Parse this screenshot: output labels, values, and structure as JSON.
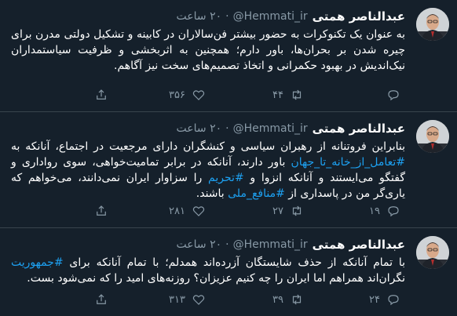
{
  "tweets": [
    {
      "name": "عبدالناصر همتی",
      "handle": "@Hemmati_ir",
      "time": "۲۰ ساعت",
      "text_parts": [
        {
          "text": "به عنوان یک تکنوکرات به حضور بیشتر فن‌سالاران در کابینه و تشکیل دولتی مدرن برای چیره شدن بر بحران‌ها، باور دارم؛ همچنین به اثربخشی و ظرفیت سیاستمداران نیک‌اندیش در بهبود حکمرانی و اتخاذ تصمیم‌های سخت نیز آگاهم.",
          "hashtag": false
        }
      ],
      "replies": "",
      "retweets": "۴۴",
      "likes": "۳۵۶"
    },
    {
      "name": "عبدالناصر همتی",
      "handle": "@Hemmati_ir",
      "time": "۲۰ ساعت",
      "text_parts": [
        {
          "text": "بنابراین فروتنانه از رهبران سیاسی و کنشگران دارای مرجعیت در اجتماع، آنانکه به ",
          "hashtag": false
        },
        {
          "text": "#تعامل_از_خانه_تا_جهان",
          "hashtag": true
        },
        {
          "text": " باور دارند، آنانکه در برابر تمامیت‌خواهی، سوی رواداری و گفتگو می‌ایستند و آنانکه انزوا و ",
          "hashtag": false
        },
        {
          "text": "#تحریم",
          "hashtag": true
        },
        {
          "text": " را سزاوار ایران نمی‌دانند، می‌خواهم که یاری‌گر من در پاسداری از ",
          "hashtag": false
        },
        {
          "text": "#منافع_ملی",
          "hashtag": true
        },
        {
          "text": " باشند.",
          "hashtag": false
        }
      ],
      "replies": "۱۹",
      "retweets": "۲۷",
      "likes": "۲۸۱"
    },
    {
      "name": "عبدالناصر همتی",
      "handle": "@Hemmati_ir",
      "time": "۲۰ ساعت",
      "text_parts": [
        {
          "text": "با تمام آنانکه از حذف شایستگان آزرده‌اند همدلم؛ با تمام آنانکه برای ",
          "hashtag": false
        },
        {
          "text": "#جمهوریت",
          "hashtag": true
        },
        {
          "text": " نگران‌اند همراهم اما ایران را چه کنیم عزیزان؟ روزنه‌های امید را که نمی‌شود بست.",
          "hashtag": false
        }
      ],
      "replies": "۲۴",
      "retweets": "۳۹",
      "likes": "۳۱۳"
    }
  ],
  "icons": {
    "reply": "reply-icon",
    "retweet": "retweet-icon",
    "like": "heart-icon",
    "share": "share-icon"
  },
  "colors": {
    "background": "#15202b",
    "divider": "#38444d",
    "text": "#ffffff",
    "secondary": "#8899a6",
    "hashtag": "#1da1f2"
  }
}
